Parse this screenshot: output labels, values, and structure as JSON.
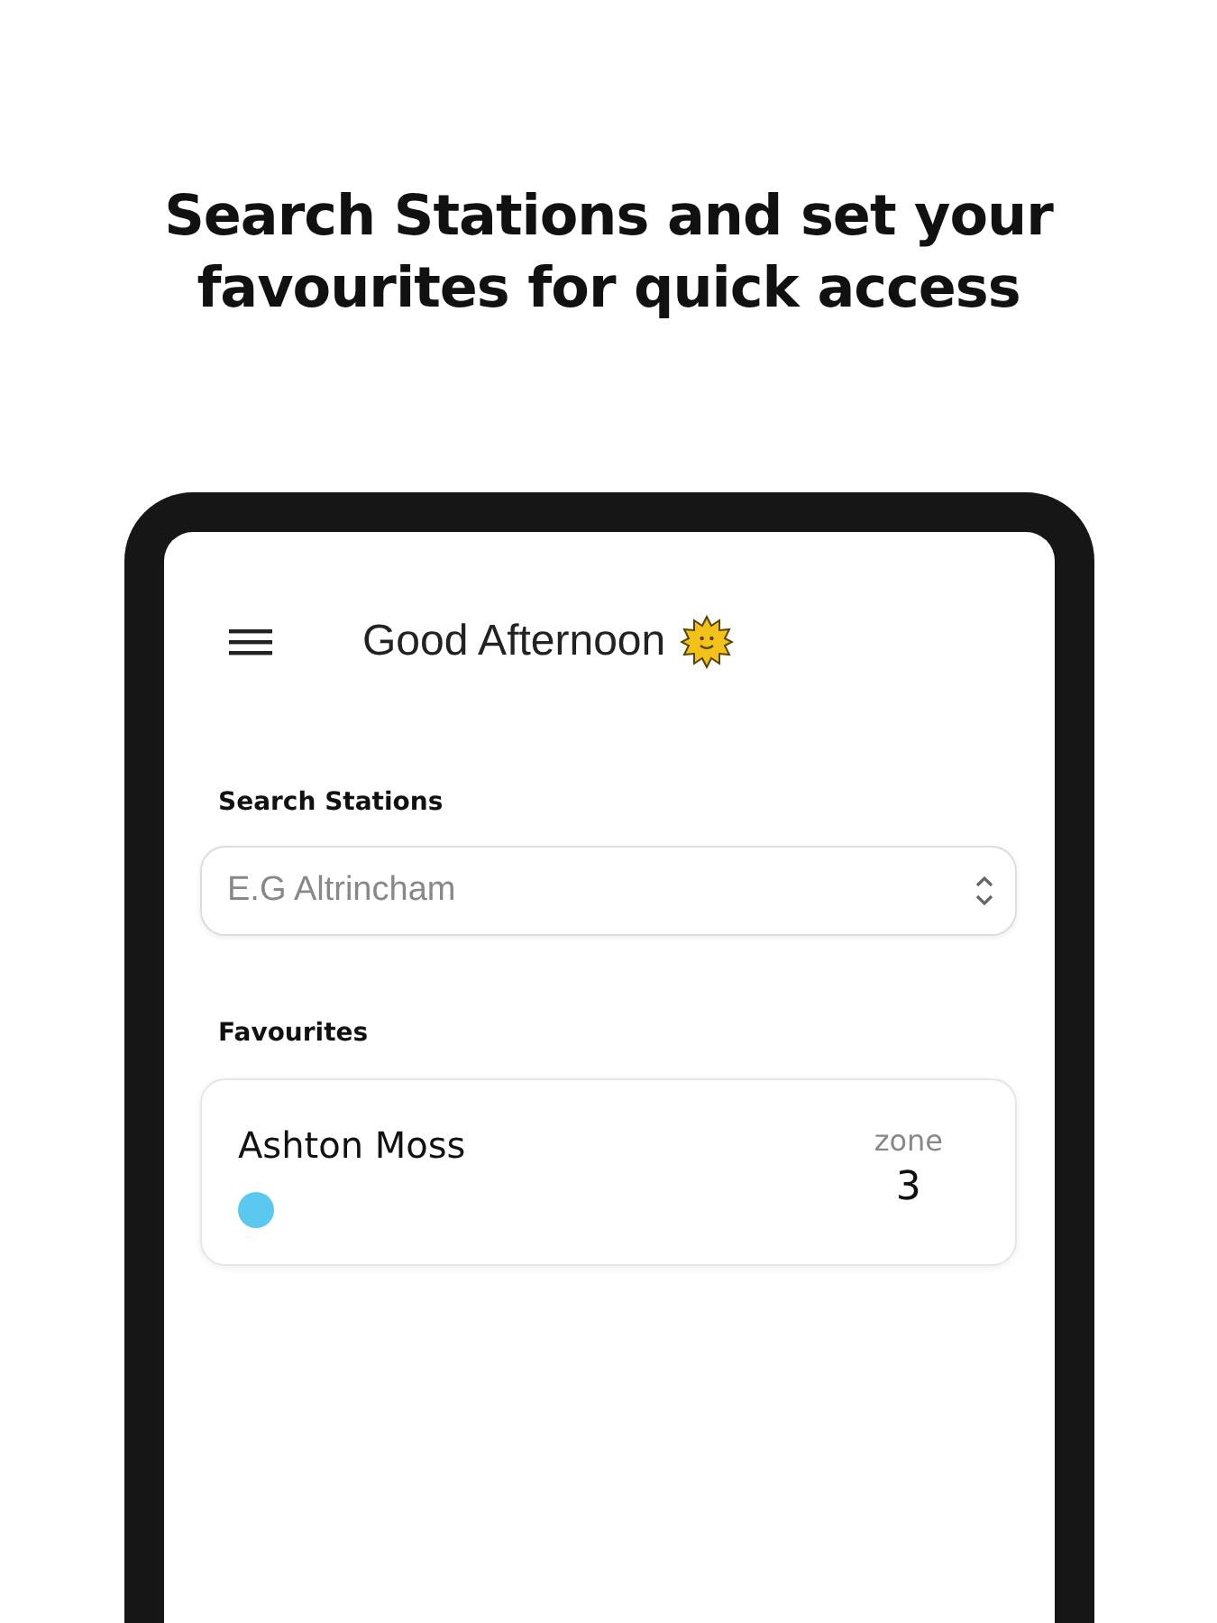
{
  "headline": "Search Stations and set your favourites for quick access",
  "app_bar": {
    "greeting": "Good Afternoon"
  },
  "search": {
    "label": "Search Stations",
    "placeholder": "E.G Altrincham"
  },
  "favourites": {
    "label": "Favourites",
    "items": [
      {
        "name": "Ashton Moss",
        "zone_label": "zone",
        "zone": "3",
        "color": "#5bc8ef"
      }
    ]
  }
}
